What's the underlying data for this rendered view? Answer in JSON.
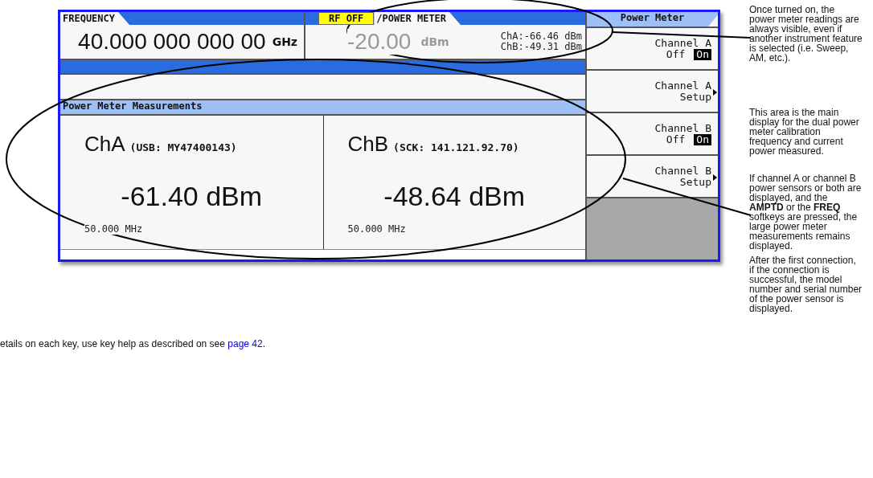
{
  "screen": {
    "frequency": {
      "label": "FREQUENCY",
      "value": "40.000 000 000 00",
      "unit": "GHz"
    },
    "amplitude": {
      "rf_badge": "RF OFF",
      "label": "/POWER METER",
      "value": "-20.00",
      "unit": "dBm",
      "disabled": true,
      "readings": [
        "ChA:-66.46 dBm",
        "ChB:-49.31 dBm"
      ]
    },
    "panel_title": "Power Meter Measurements",
    "channels": [
      {
        "name": "ChA",
        "sensor": "(USB: MY47400143)",
        "reading": "-61.40 dBm",
        "frequency": "50.000 MHz"
      },
      {
        "name": "ChB",
        "sensor": "(SCK: 141.121.92.70)",
        "reading": "-48.64 dBm",
        "frequency": "50.000 MHz"
      }
    ],
    "softkeys": {
      "title": "Power Meter",
      "keys": [
        {
          "kind": "toggle",
          "label": "Channel A",
          "options": [
            {
              "label": "Off",
              "selected": false
            },
            {
              "label": "On",
              "selected": true
            }
          ]
        },
        {
          "kind": "submenu",
          "label": "Channel A",
          "sublabel": "Setup"
        },
        {
          "kind": "toggle",
          "label": "Channel B",
          "options": [
            {
              "label": "Off",
              "selected": false
            },
            {
              "label": "On",
              "selected": true
            }
          ]
        },
        {
          "kind": "submenu",
          "label": "Channel B",
          "sublabel": "Setup"
        }
      ]
    }
  },
  "annotations": [
    {
      "text": "Once turned on, the power meter readings are always visible, even if another instrument feature is selected (i.e. Sweep, AM, etc.)."
    },
    {
      "text": "This area is the main display for the dual power meter calibration frequency and current power measured."
    },
    {
      "text": "If channel A or channel B power sensors or both are displayed, and the **AMPTD** or the **FREQ** softkeys are pressed, the large power meter measurements remains displayed."
    },
    {
      "text": "After the first connection, if the connection is successful, the model number and serial number of the power sensor is displayed."
    }
  ],
  "footer": {
    "text": "etails on each key, use key help as described on see ",
    "link": "page 42",
    "end": "."
  }
}
